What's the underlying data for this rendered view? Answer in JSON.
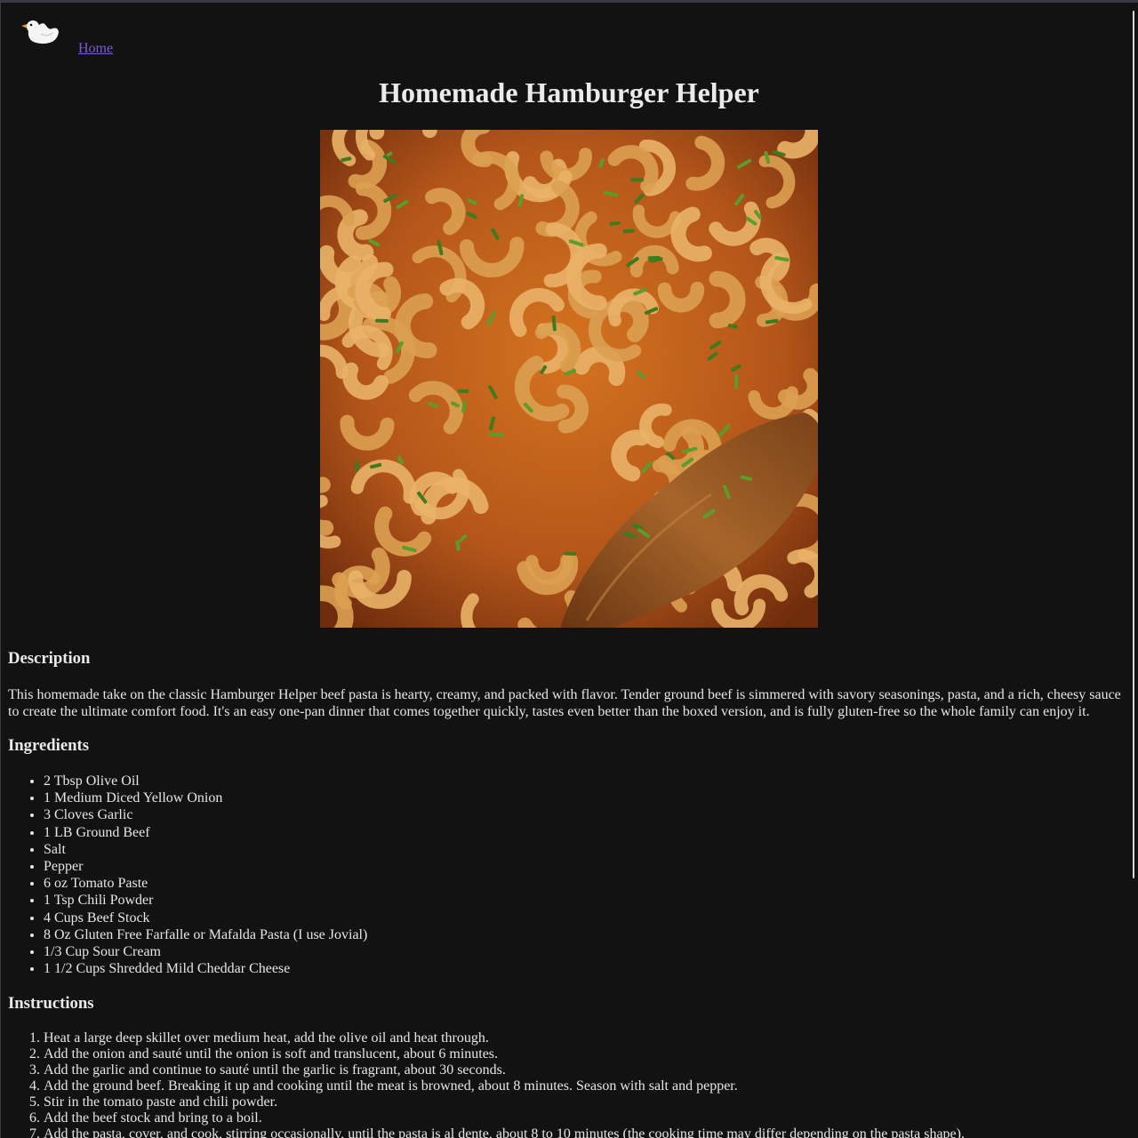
{
  "nav": {
    "logo_icon": "duck-logo-icon",
    "home_label": "Home"
  },
  "recipe": {
    "title": "Homemade Hamburger Helper",
    "image_icon": "hamburger-helper-photo",
    "description_heading": "Description",
    "description": "This homemade take on the classic Hamburger Helper beef pasta is hearty, creamy, and packed with flavor. Tender ground beef is simmered with savory seasonings, pasta, and a rich, cheesy sauce to create the ultimate comfort food. It's an easy one-pan dinner that comes together quickly, tastes even better than the boxed version, and is fully gluten-free so the whole family can enjoy it.",
    "ingredients_heading": "Ingredients",
    "ingredients": [
      "2 Tbsp Olive Oil",
      "1 Medium Diced Yellow Onion",
      "3 Cloves Garlic",
      "1 LB Ground Beef",
      "Salt",
      "Pepper",
      "6 oz Tomato Paste",
      "1 Tsp Chili Powder",
      "4 Cups Beef Stock",
      "8 Oz Gluten Free Farfalle or Mafalda Pasta (I use Jovial)",
      "1/3 Cup Sour Cream",
      "1 1/2 Cups Shredded Mild Cheddar Cheese"
    ],
    "instructions_heading": "Instructions",
    "instructions": [
      "Heat a large deep skillet over medium heat, add the olive oil and heat through.",
      "Add the onion and sauté until the onion is soft and translucent, about 6 minutes.",
      "Add the garlic and continue to sauté until the garlic is fragrant, about 30 seconds.",
      "Add the ground beef. Breaking it up and cooking until the meat is browned, about 8 minutes. Season with salt and pepper.",
      "Stir in the tomato paste and chili powder.",
      "Add the beef stock and bring to a boil.",
      "Add the pasta, cover, and cook, stirring occasionally, until the pasta is al dente, about 8 to 10 minutes (the cooking time may differ depending on the pasta shape)."
    ]
  },
  "colors": {
    "background": "#121212",
    "text": "#e6e6e6",
    "link": "#7b5bd6",
    "sauce": "#c0601c"
  }
}
